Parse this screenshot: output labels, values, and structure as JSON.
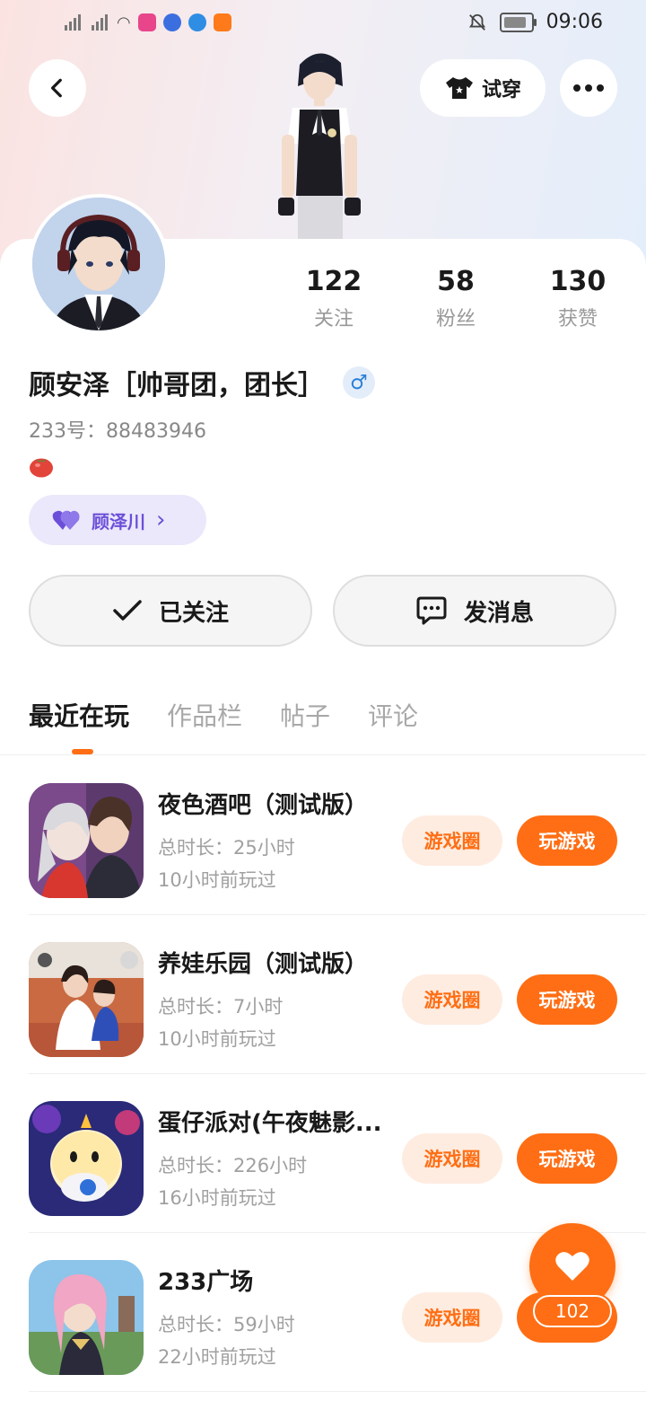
{
  "status_bar": {
    "time": "09:06"
  },
  "header": {
    "try_on_label": "试穿"
  },
  "stats": [
    {
      "value": "122",
      "label": "关注"
    },
    {
      "value": "58",
      "label": "粉丝"
    },
    {
      "value": "130",
      "label": "获赞"
    }
  ],
  "profile": {
    "name": "顾安泽［帅哥团，团长］",
    "gender_symbol": "♂",
    "uid": "233号：88483946",
    "partner_name": "顾泽川",
    "partner_chevron": "›"
  },
  "actions": {
    "followed_label": "已关注",
    "message_label": "发消息"
  },
  "tabs": [
    "最近在玩",
    "作品栏",
    "帖子",
    "评论"
  ],
  "games": [
    {
      "title": "夜色酒吧（测试版）",
      "duration": "总时长：25小时",
      "last_played": "10小时前玩过",
      "circle_label": "游戏圈",
      "play_label": "玩游戏"
    },
    {
      "title": "养娃乐园（测试版）",
      "duration": "总时长：7小时",
      "last_played": "10小时前玩过",
      "circle_label": "游戏圈",
      "play_label": "玩游戏"
    },
    {
      "title": "蛋仔派对(午夜魅影...",
      "duration": "总时长：226小时",
      "last_played": "16小时前玩过",
      "circle_label": "游戏圈",
      "play_label": "玩游戏"
    },
    {
      "title": "233广场",
      "duration": "总时长：59小时",
      "last_played": "22小时前玩过",
      "circle_label": "游戏圈",
      "play_label": "玩游戏"
    }
  ],
  "like_fab": {
    "count": "102"
  },
  "colors": {
    "accent": "#ff6e14",
    "accent_light": "#ffece0",
    "partner_purple": "#6b4fd8"
  }
}
